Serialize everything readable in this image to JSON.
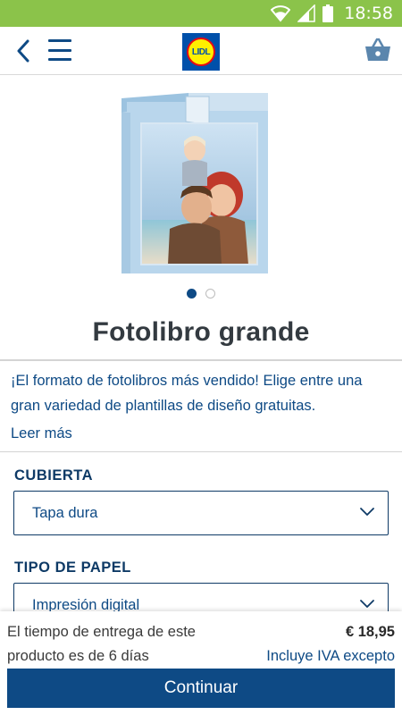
{
  "status_bar": {
    "time": "18:58",
    "icons": [
      "wifi-icon",
      "signal-icon",
      "battery-icon"
    ]
  },
  "header": {
    "back_icon": "chevron-left-icon",
    "menu_icon": "hamburger-menu-icon",
    "logo_text": "LIDL",
    "basket_icon": "shopping-basket-icon"
  },
  "product": {
    "image_icon": "photobook-image",
    "carousel_total": 2,
    "carousel_active": 1,
    "title": "Fotolibro grande",
    "description": "¡El formato de fotolibros más vendido! Elige entre una gran variedad de plantillas de diseño gratuitas.",
    "read_more": "Leer más"
  },
  "options": {
    "cover": {
      "label": "CUBIERTA",
      "selected": "Tapa dura"
    },
    "paper": {
      "label": "TIPO DE PAPEL",
      "selected": "Impresión digital"
    }
  },
  "footer": {
    "delivery_text": "El tiempo de entrega de este producto es de 6 días",
    "price": "€ 18,95",
    "vat_note": "Incluye IVA excepto",
    "continue_label": "Continuar"
  },
  "colors": {
    "status_bar": "#8bc34a",
    "primary": "#0e4a85",
    "logo_blue": "#0050aa",
    "logo_yellow": "#fff000",
    "logo_red": "#e60a14"
  }
}
